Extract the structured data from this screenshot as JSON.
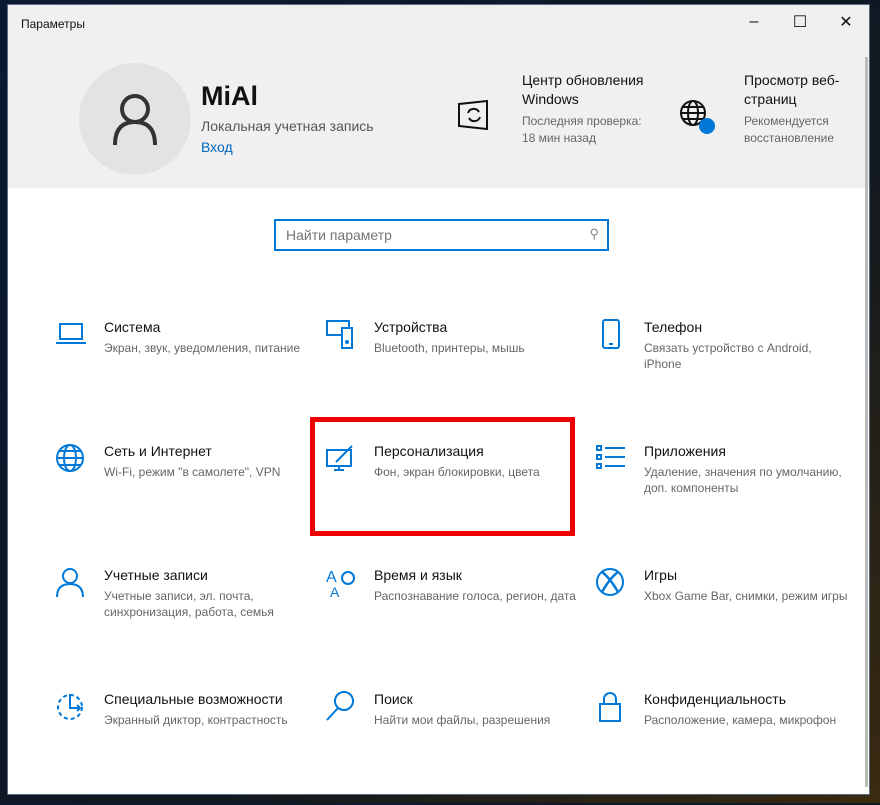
{
  "window": {
    "title": "Параметры",
    "minimize": "–",
    "maximize": "☐",
    "close": "✕"
  },
  "account": {
    "name": "MiAl",
    "type": "Локальная учетная запись",
    "login": "Вход"
  },
  "quick": [
    {
      "title": "Центр обновления Windows",
      "sub": "Последняя проверка: 18 мин назад",
      "icon": "update-icon"
    },
    {
      "title": "Просмотр веб-страниц",
      "sub": "Рекомендуется восстановление",
      "icon": "globe-icon"
    }
  ],
  "search": {
    "placeholder": "Найти параметр",
    "value": ""
  },
  "tiles": [
    {
      "title": "Система",
      "desc": "Экран, звук, уведомления, питание",
      "icon": "laptop-icon"
    },
    {
      "title": "Устройства",
      "desc": "Bluetooth, принтеры, мышь",
      "icon": "devices-icon"
    },
    {
      "title": "Телефон",
      "desc": "Связать устройство с Android, iPhone",
      "icon": "phone-icon"
    },
    {
      "title": "Сеть и Интернет",
      "desc": "Wi-Fi, режим \"в самолете\", VPN",
      "icon": "globe-icon"
    },
    {
      "title": "Персонализация",
      "desc": "Фон, экран блокировки, цвета",
      "icon": "personalization-icon"
    },
    {
      "title": "Приложения",
      "desc": "Удаление, значения по умолчанию, доп. компоненты",
      "icon": "apps-icon"
    },
    {
      "title": "Учетные записи",
      "desc": "Учетные записи, эл. почта, синхронизация, работа, семья",
      "icon": "person-icon"
    },
    {
      "title": "Время и язык",
      "desc": "Распознавание голоса, регион, дата",
      "icon": "time-language-icon"
    },
    {
      "title": "Игры",
      "desc": "Xbox Game Bar, снимки, режим игры",
      "icon": "xbox-icon"
    },
    {
      "title": "Специальные возможности",
      "desc": "Экранный диктор, контрастность",
      "icon": "accessibility-icon"
    },
    {
      "title": "Поиск",
      "desc": "Найти мои файлы, разрешения",
      "icon": "search-icon"
    },
    {
      "title": "Конфиденциальность",
      "desc": "Расположение, камера, микрофон",
      "icon": "lock-icon"
    }
  ],
  "colors": {
    "accent": "#0078d7",
    "highlight": "#e00000"
  }
}
